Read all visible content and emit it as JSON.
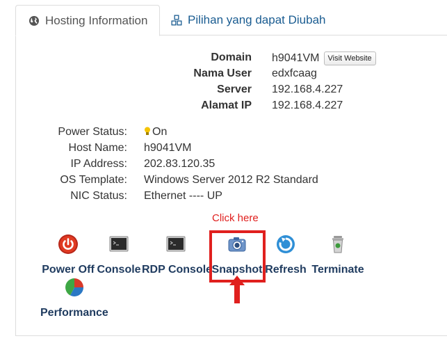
{
  "tabs": {
    "active": {
      "label": "Hosting Information",
      "icon": "globe-icon"
    },
    "inactive": {
      "label": "Pilihan yang dapat Diubah",
      "icon": "cubes-icon"
    }
  },
  "hosting": {
    "rows": [
      {
        "label": "Domain",
        "value": "h9041VM"
      },
      {
        "label": "Nama User",
        "value": "edxfcaag"
      },
      {
        "label": "Server",
        "value": "192.168.4.227"
      },
      {
        "label": "Alamat IP",
        "value": "192.168.4.227"
      }
    ],
    "visit_button": "Visit Website"
  },
  "vm": {
    "rows": [
      {
        "label": "Power Status:",
        "value": "On"
      },
      {
        "label": "Host Name:",
        "value": "h9041VM"
      },
      {
        "label": "IP Address:",
        "value": "202.83.120.35"
      },
      {
        "label": "OS Template:",
        "value": "Windows Server 2012 R2 Standard"
      },
      {
        "label": "NIC Status:",
        "value": "Ethernet ---- UP"
      }
    ]
  },
  "actions": [
    {
      "label": "Power Off",
      "icon": "power-icon"
    },
    {
      "label": "Console",
      "icon": "terminal-icon"
    },
    {
      "label": "RDP Console",
      "icon": "terminal-icon"
    },
    {
      "label": "Snapshot",
      "icon": "camera-icon"
    },
    {
      "label": "Refresh",
      "icon": "refresh-icon"
    },
    {
      "label": "Terminate",
      "icon": "trash-icon"
    },
    {
      "label": "Performance",
      "icon": "pie-chart-icon"
    }
  ],
  "annotation": {
    "text": "Click here",
    "color": "#e0201e"
  },
  "colors": {
    "link": "#1a5c91",
    "action_label": "#1f3b5f",
    "accent_red": "#e0201e"
  }
}
